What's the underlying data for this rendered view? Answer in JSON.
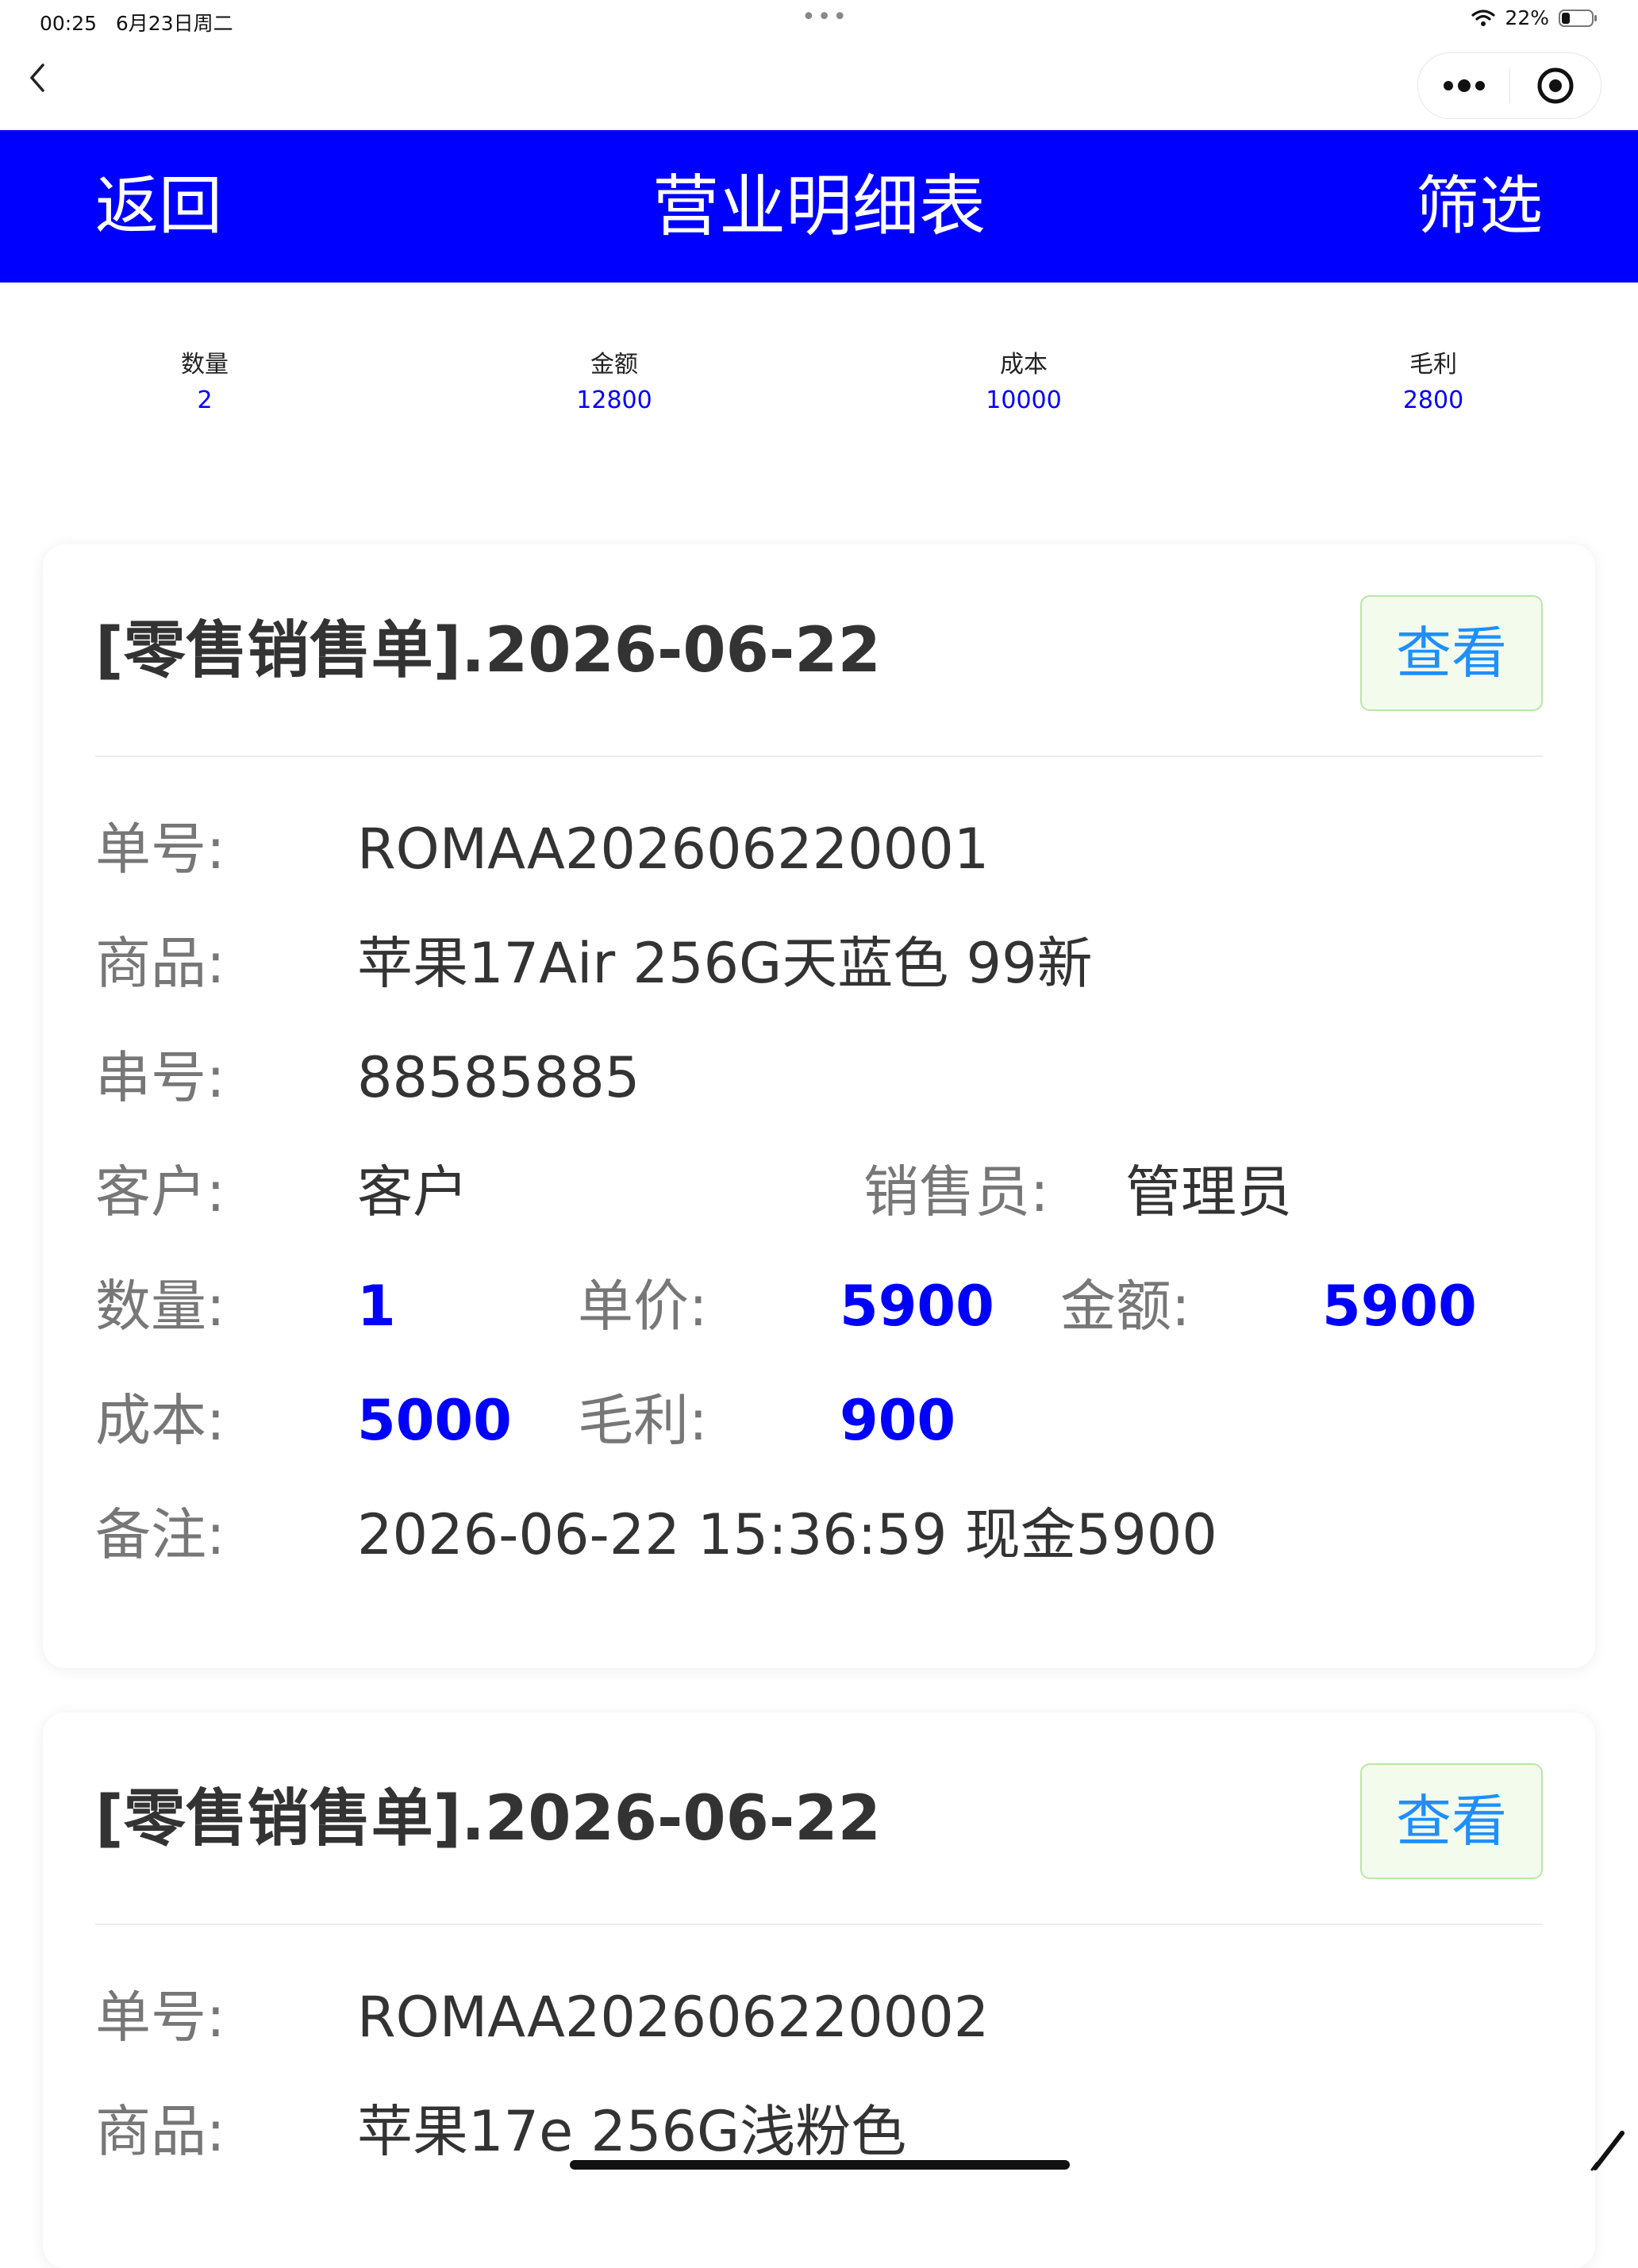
{
  "status_bar": {
    "time": "00:25",
    "date": "6月23日周二",
    "battery": "22%"
  },
  "header": {
    "back_label": "返回",
    "title": "营业明细表",
    "filter_label": "筛选"
  },
  "summary": [
    {
      "label": "数量",
      "value": "2"
    },
    {
      "label": "金额",
      "value": "12800"
    },
    {
      "label": "成本",
      "value": "10000"
    },
    {
      "label": "毛利",
      "value": "2800"
    }
  ],
  "labels": {
    "order_no": "单号:",
    "product": "商品:",
    "serial": "串号:",
    "customer": "客户:",
    "salesperson": "销售员:",
    "quantity": "数量:",
    "unit_price": "单价:",
    "amount": "金额:",
    "cost": "成本:",
    "profit": "毛利:",
    "remark": "备注:",
    "view_button": "查看"
  },
  "records": [
    {
      "title": "[零售销售单].2026-06-22",
      "order_no": "ROMAA202606220001",
      "product": "苹果17Air 256G天蓝色 99新",
      "serial": "88585885",
      "customer": "客户",
      "salesperson": "管理员",
      "quantity": "1",
      "unit_price": "5900",
      "amount": "5900",
      "cost": "5000",
      "profit": "900",
      "remark": "2026-06-22 15:36:59 现金5900"
    },
    {
      "title": "[零售销售单].2026-06-22",
      "order_no": "ROMAA202606220002",
      "product": "苹果17e 256G浅粉色"
    }
  ],
  "colors": {
    "header_bg": "#0000ff",
    "value_blue": "#0000ff",
    "button_text": "#1e8fff",
    "button_bg": "#f2fbec",
    "button_border": "#b9e7a5"
  }
}
